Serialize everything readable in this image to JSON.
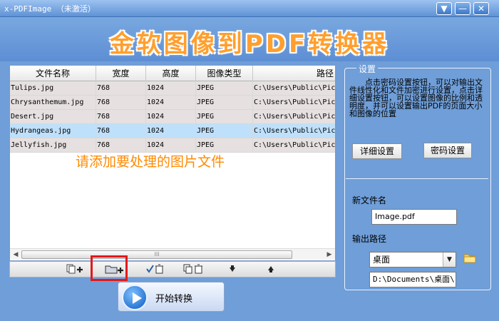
{
  "window": {
    "title": "x-PDFImage （未激活）",
    "min_glyph": "▼",
    "close_glyph": "—",
    "max_glyph": "✕"
  },
  "banner": {
    "title": "金软图像到PDF转换器"
  },
  "table": {
    "headers": [
      "文件名称",
      "宽度",
      "高度",
      "图像类型",
      "路径"
    ],
    "rows": [
      [
        "Tulips.jpg",
        "768",
        "1024",
        "JPEG",
        "C:\\Users\\Public\\Pic"
      ],
      [
        "Chrysanthemum.jpg",
        "768",
        "1024",
        "JPEG",
        "C:\\Users\\Public\\Pic"
      ],
      [
        "Desert.jpg",
        "768",
        "1024",
        "JPEG",
        "C:\\Users\\Public\\Pic"
      ],
      [
        "Hydrangeas.jpg",
        "768",
        "1024",
        "JPEG",
        "C:\\Users\\Public\\Pic"
      ],
      [
        "Jellyfish.jpg",
        "768",
        "1024",
        "JPEG",
        "C:\\Users\\Public\\Pic"
      ]
    ],
    "selected_row": 3,
    "hint": "请添加要处理的图片文件"
  },
  "scrollbar": {
    "thumb_grip": "III",
    "left_arrow": "◀",
    "right_arrow": "▶"
  },
  "toolbar": {
    "add_file_icon": "add-file-icon",
    "add_folder_icon": "add-folder-icon",
    "remove_selected_icon": "remove-selected-icon",
    "remove_all_icon": "remove-all-icon",
    "move_down_icon": "move-down-icon",
    "move_up_icon": "move-up-icon",
    "highlight_color": "#e21a1a"
  },
  "start": {
    "label": "开始转换"
  },
  "settings": {
    "group_title": "设置",
    "description": "点击密码设置按钮，可以对输出文件线性化和文件加密进行设置，点击详细设置按钮，可以设置图像的比例和透明度，并可以设置输出PDF的页面大小和图像的位置",
    "detail_button": "详细设置",
    "password_button": "密码设置",
    "new_filename_label": "新文件名",
    "new_filename_value": "Image.pdf",
    "output_path_label": "输出路径",
    "output_path_selected": "桌面",
    "output_path_value": "D:\\Documents\\桌面\\"
  },
  "colors": {
    "background": "#6f9ed8",
    "banner_text": "#ff9f2e",
    "hint_text": "#ff8a00",
    "selected_row": "#bfe0fb"
  }
}
